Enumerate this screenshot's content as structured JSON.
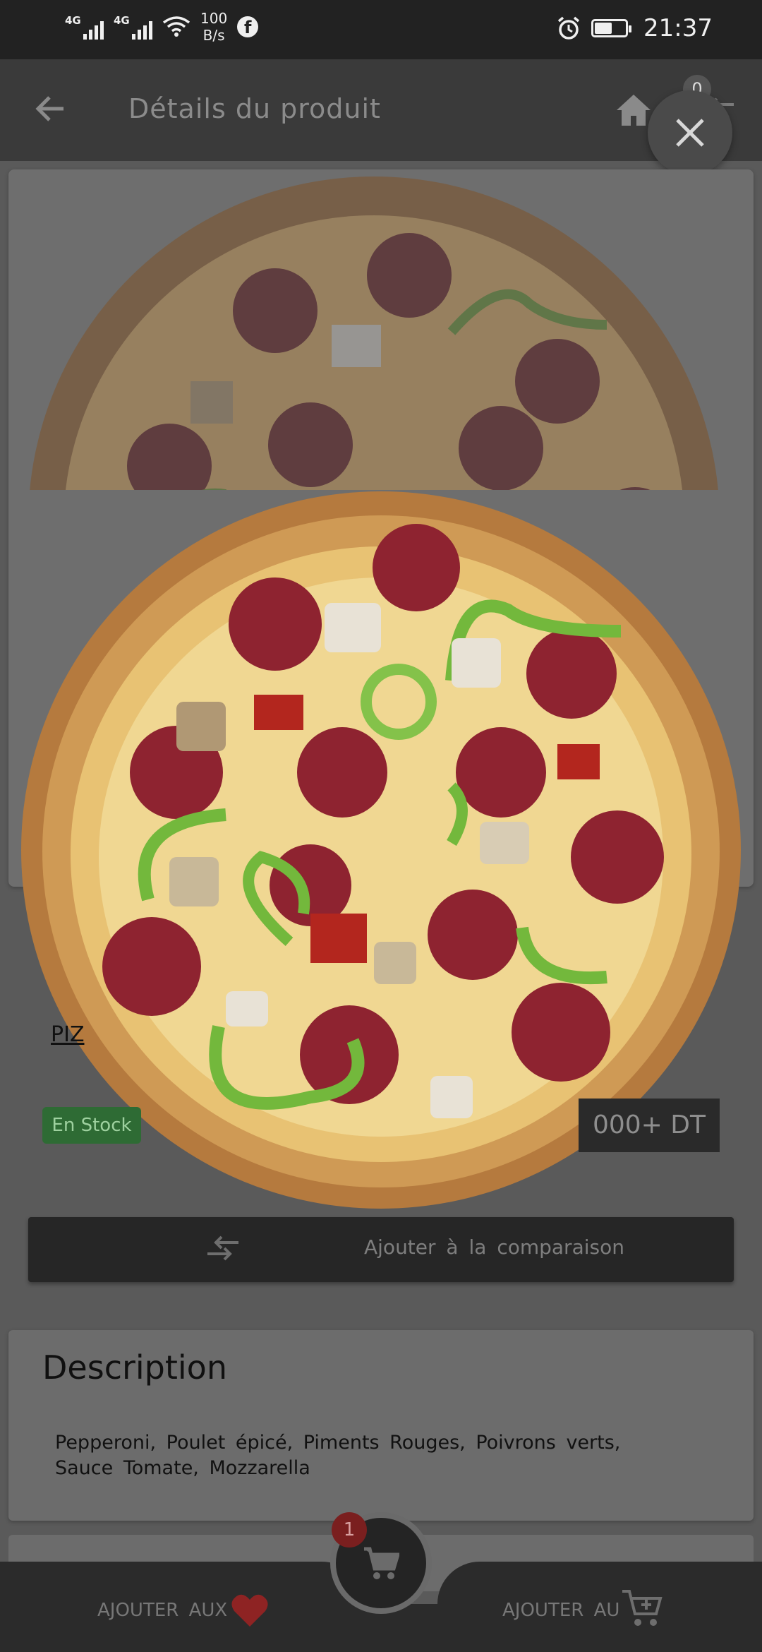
{
  "status_bar": {
    "network_1": "4G",
    "network_2": "4G",
    "speed_value": "100",
    "speed_unit": "B/s",
    "time": "21:37",
    "battery_level": 0.55
  },
  "app_bar": {
    "title": "Détails du produit",
    "compare_count": "0"
  },
  "product": {
    "name_partial": "PIZ",
    "stock_status": "En Stock",
    "price_partial": "000+ DT"
  },
  "compare_button": {
    "label": "Ajouter à la comparaison"
  },
  "description": {
    "title": "Description",
    "text": "Pepperoni, Poulet épicé, Piments Rouges, Poivrons verts, Sauce Tomate, Mozzarella"
  },
  "bottom_bar": {
    "favorites_label": "AJOUTER AUX",
    "cart_label": "AJOUTER AU",
    "cart_count": "1"
  }
}
